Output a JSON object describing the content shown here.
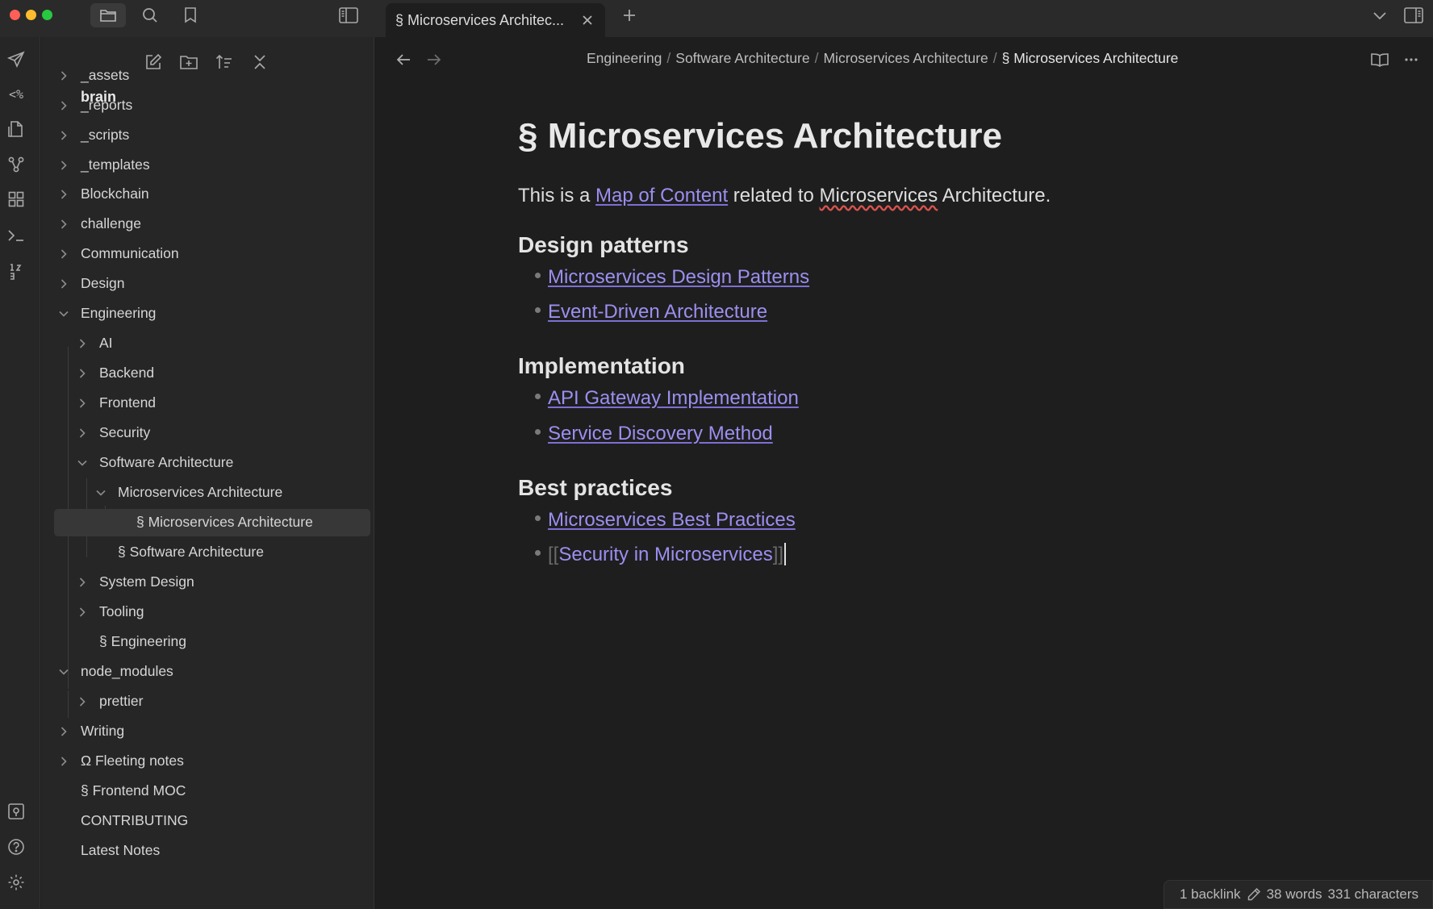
{
  "window": {
    "traffic_colors": [
      "#ff5f57",
      "#febc2e",
      "#28c840"
    ],
    "tab_title": "§ Microservices Architec...",
    "icons": [
      "folder-icon",
      "search-icon",
      "bookmark-icon",
      "sidebar-toggle-icon",
      "close-icon",
      "plus-icon",
      "chevron-down-icon",
      "right-sidebar-icon"
    ]
  },
  "ribbon": {
    "template_label": "<%",
    "icons": [
      "send-icon",
      "template-icon",
      "document-icon",
      "graph-icon",
      "grid-icon",
      "terminal-icon",
      "number-icon",
      "vault-icon",
      "help-icon",
      "settings-icon"
    ]
  },
  "sidebar": {
    "vault_name": "brain",
    "tools": [
      "new-note-icon",
      "new-folder-icon",
      "sort-icon",
      "collapse-all-icon"
    ],
    "items": [
      {
        "label": "_assets"
      },
      {
        "label": "_reports"
      },
      {
        "label": "_scripts"
      },
      {
        "label": "_templates"
      },
      {
        "label": "Blockchain"
      },
      {
        "label": "challenge"
      },
      {
        "label": "Communication"
      },
      {
        "label": "Design"
      },
      {
        "label": "Engineering"
      },
      {
        "label": "AI"
      },
      {
        "label": "Backend"
      },
      {
        "label": "Frontend"
      },
      {
        "label": "Security"
      },
      {
        "label": "Software Architecture"
      },
      {
        "label": "Microservices Architecture"
      },
      {
        "label": "§ Microservices Architecture"
      },
      {
        "label": "§ Software Architecture"
      },
      {
        "label": "System Design"
      },
      {
        "label": "Tooling"
      },
      {
        "label": "§ Engineering"
      },
      {
        "label": "node_modules"
      },
      {
        "label": "prettier"
      },
      {
        "label": "Writing"
      },
      {
        "label": "Ω Fleeting notes"
      },
      {
        "label": "§ Frontend MOC"
      },
      {
        "label": "CONTRIBUTING"
      },
      {
        "label": "Latest Notes"
      }
    ]
  },
  "breadcrumb": {
    "items": [
      "Engineering",
      "Software Architecture",
      "Microservices Architecture"
    ],
    "current": "§ Microservices Architecture",
    "separator": "/"
  },
  "note": {
    "title": "§ Microservices Architecture",
    "intro_before": "This is a ",
    "intro_link": "Map of Content",
    "intro_middle": " related to ",
    "intro_misspelled": "Microservices",
    "intro_after": " Architecture.",
    "sections": [
      {
        "heading": "Design patterns",
        "links": [
          "Microservices Design Patterns",
          "Event-Driven Architecture"
        ]
      },
      {
        "heading": "Implementation",
        "links": [
          "API Gateway Implementation",
          "Service Discovery Method"
        ]
      },
      {
        "heading": "Best practices",
        "links": [
          "Microservices Best Practices"
        ]
      }
    ],
    "raw_link": {
      "open": "[[",
      "text": "Security in Microservices",
      "close": "]]"
    }
  },
  "status": {
    "backlinks": "1 backlink",
    "words": "38 words",
    "characters": "331 characters"
  },
  "colors": {
    "accent": "#9b8ff0",
    "background": "#1e1e1e",
    "sidebar": "#262626"
  }
}
